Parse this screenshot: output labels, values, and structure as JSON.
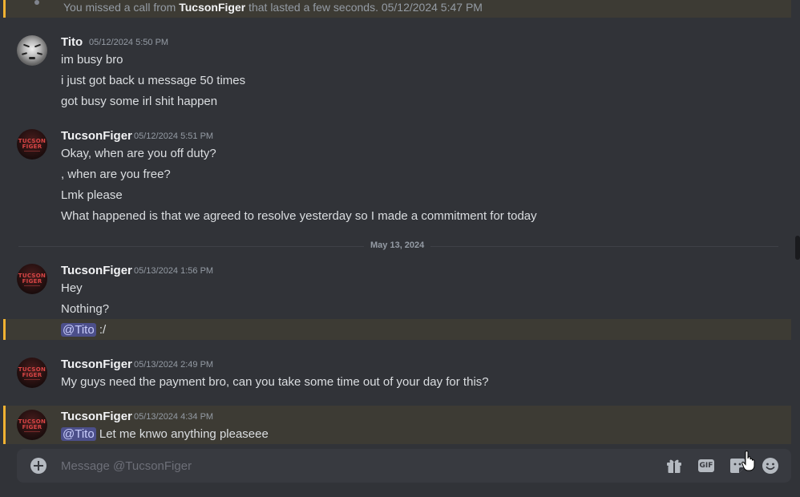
{
  "system": {
    "text_prefix": "You missed a call from ",
    "caller": "TucsonFiger",
    "text_suffix": " that lasted a few seconds. 05/12/2024 5:47 PM"
  },
  "messages": [
    {
      "username": "Tito",
      "timestamp": "05/12/2024 5:50 PM",
      "lines": [
        "im busy bro",
        "i just got back u message 50 times",
        "got busy some irl shit happen"
      ]
    },
    {
      "username": "TucsonFiger",
      "timestamp": "05/12/2024 5:51 PM",
      "lines": [
        "Okay, when are you off duty?",
        ", when are you free?",
        "Lmk please",
        "What happened is that we agreed to resolve yesterday so I made a commitment for today"
      ]
    },
    {
      "username": "TucsonFiger",
      "timestamp": "05/13/2024 1:56 PM",
      "lines": [
        "Hey",
        "Nothing?"
      ],
      "mention_line": {
        "mention": "@Tito",
        "text": " :/"
      }
    },
    {
      "username": "TucsonFiger",
      "timestamp": "05/13/2024 2:49 PM",
      "lines": [
        "My guys need the payment bro, can you take some time out of your day for this?"
      ]
    },
    {
      "username": "TucsonFiger",
      "timestamp": "05/13/2024 4:34 PM",
      "mention_line": {
        "mention": "@Tito",
        "text": " Let me knwo anything pleaseee"
      }
    }
  ],
  "date_divider": "May 13, 2024",
  "avatar_text": {
    "line1": "TUCSON",
    "line2": "FIGER"
  },
  "composer": {
    "placeholder": "Message @TucsonFiger",
    "gif_label": "GIF"
  },
  "icons": [
    "plus-circle-icon",
    "gift-icon",
    "gif-icon",
    "sticker-icon",
    "emoji-icon"
  ],
  "colors": {
    "background": "#313338",
    "composer": "#383a40",
    "highlight": "#3d3b34",
    "highlight_border": "#f0b232",
    "mention": "#4c4f8a"
  }
}
